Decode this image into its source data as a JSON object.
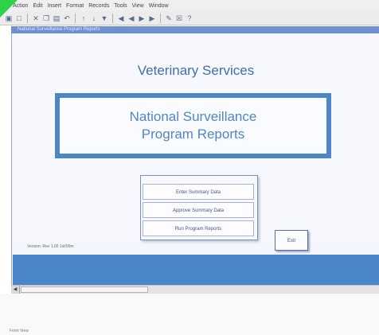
{
  "menu": [
    "Action",
    "Edit",
    "Insert",
    "Format",
    "Records",
    "Tools",
    "View",
    "Window"
  ],
  "toolbar_icons": [
    "save-icon",
    "print-icon",
    "cut-icon",
    "copy-icon",
    "paste-icon",
    "undo-icon",
    "redo-icon",
    "sort-asc-icon",
    "sort-desc-icon",
    "filter-icon",
    "first-record-icon",
    "prev-record-icon",
    "next-record-icon",
    "last-record-icon",
    "new-record-icon",
    "delete-record-icon",
    "help-icon"
  ],
  "window_title": "National Surveillance Program Reports",
  "form": {
    "heading": "Veterinary Services",
    "panel_line1": "National Surveillance",
    "panel_line2": "Program Reports",
    "buttons": [
      "Enter Summary Data",
      "Approve Summary Data",
      "Run Program Reports"
    ],
    "exit_label": "Exit",
    "version": "Version: Rev 1.00 1st/99m"
  },
  "status": "Form View",
  "colors": {
    "brand_blue": "#4a86c8",
    "heading_blue": "#3f6fb0",
    "title_bar": "#6f8fcf"
  }
}
